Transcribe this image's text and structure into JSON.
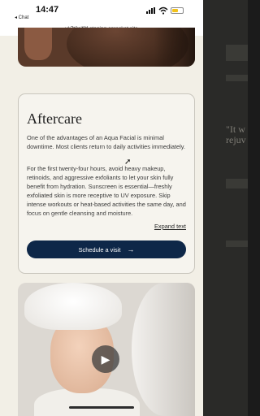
{
  "status_bar": {
    "time": "14:47",
    "back_label": "◂ Chat"
  },
  "browser": {
    "url": "vk7t2ejf8f-staging.onrocket.site"
  },
  "aftercare": {
    "title": "Aftercare",
    "paragraph_1": "One of the advantages of an Aqua Facial is minimal downtime. Most clients return to daily activities immediately.",
    "paragraph_2": "For the first twenty-four hours, avoid heavy makeup, retinoids, and aggressive exfoliants to let your skin fully benefit from hydration. Sunscreen is essential—freshly exfoliated skin is more receptive to UV exposure. Skip intense workouts or heat-based activities the same day, and focus on gentle cleansing and moisture.",
    "expand_label": "Expand text",
    "cta_label": "Schedule a visit",
    "cta_icon": "→"
  },
  "video": {
    "play_icon": "▶"
  },
  "background_page": {
    "text_1": "\"It w",
    "text_2": "rejuv"
  }
}
